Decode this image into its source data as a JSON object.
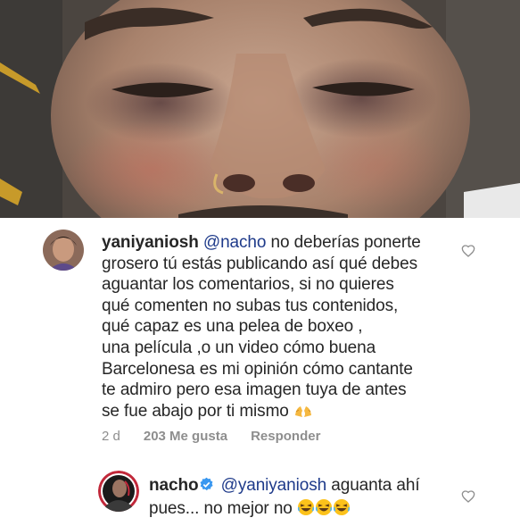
{
  "comment": {
    "username": "yaniyaniosh",
    "mention": "@nacho",
    "lines": [
      " no deberías ponerte",
      "grosero tú estás publicando así qué debes",
      "aguantar los comentarios, si no quieres",
      "qué comenten no subas tus contenidos,",
      "qué capaz  es una pelea de boxeo ,",
      "una película ,o un video cómo buena",
      "Barcelonesa es mi opinión cómo cantante",
      "te admiro pero esa imagen tuya de antes",
      "se fue abajo por ti mismo "
    ],
    "trailing_emoji": "hands-icon",
    "time": "2 d",
    "likes": "203 Me gusta",
    "reply_label": "Responder"
  },
  "reply": {
    "username": "nacho",
    "verified_icon": "verified-badge-icon",
    "mention": "@yaniyaniosh",
    "line1_rest": " aguanta ahí",
    "line2": "pues... no mejor no ",
    "emojis": [
      "laughing-face-icon",
      "laughing-face-icon",
      "laughing-face-icon"
    ]
  },
  "colors": {
    "mention": "#1e3a8a",
    "verified": "#3897f0",
    "meta": "#8e8e8e",
    "text": "#262626"
  }
}
